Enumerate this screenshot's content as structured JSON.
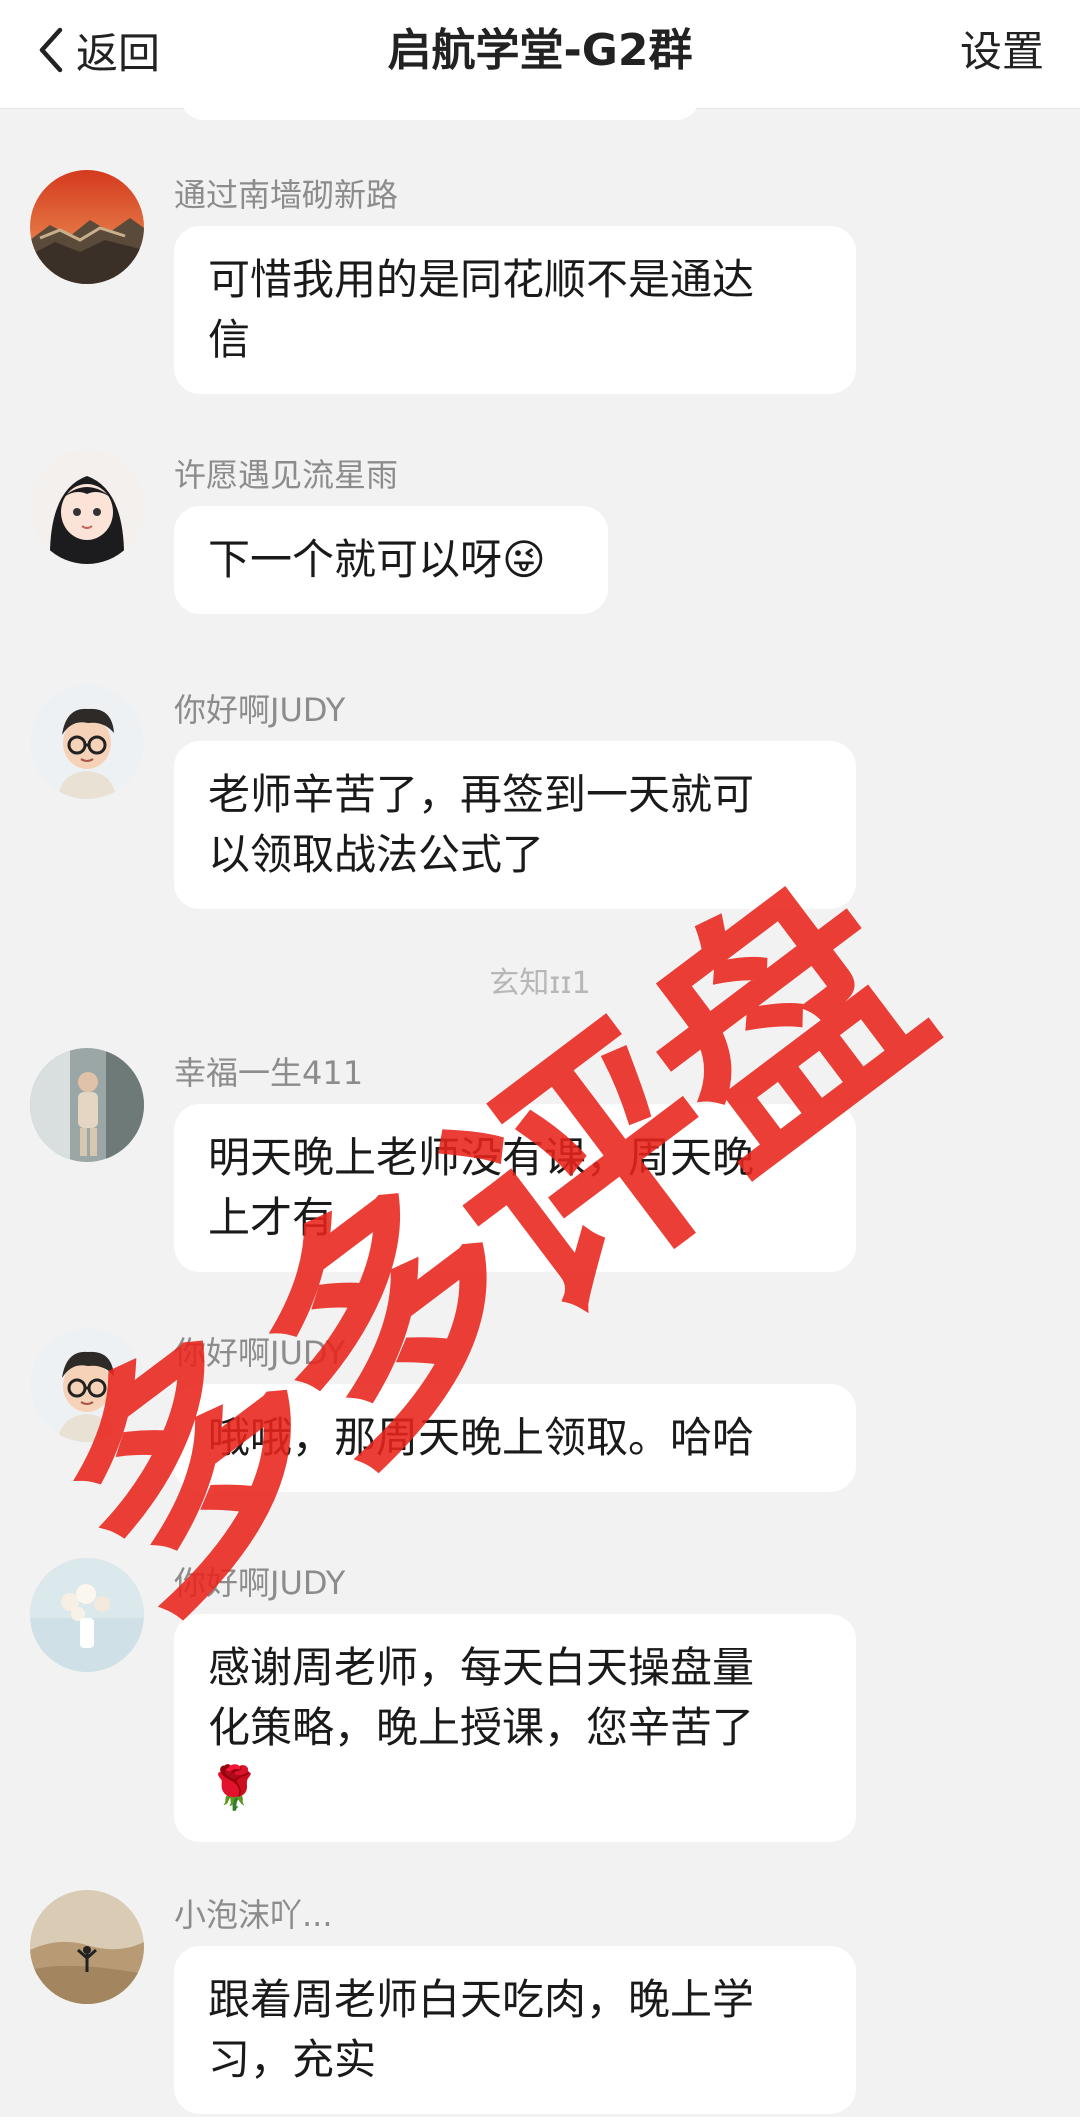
{
  "header": {
    "back_label": "返回",
    "title": "启航学堂-G2群",
    "settings_label": "设置"
  },
  "messages": [
    {
      "name": "通过南墙砌新路",
      "lines": [
        "可惜我用的是同花顺不是通达",
        "信"
      ],
      "avatar": "great-wall-sunset-avatar"
    },
    {
      "name": "许愿遇见流星雨",
      "lines": [
        "下一个就可以呀😜"
      ],
      "avatar": "anime-girl-avatar"
    },
    {
      "name": "你好啊JUDY",
      "lines": [
        "老师辛苦了，再签到一天就可",
        "以领取战法公式了"
      ],
      "avatar": "cartoon-boy-glasses-avatar"
    },
    {
      "name": "幸福一生411",
      "lines": [
        "明天晚上老师没有课，周天晚",
        "上才有"
      ],
      "avatar": "person-photo-avatar"
    },
    {
      "name": "你好啊JUDY",
      "lines": [
        "哦哦，那周天晚上领取。哈哈"
      ],
      "avatar": "cartoon-boy-glasses-avatar"
    },
    {
      "name": "你好啊JUDY",
      "lines": [
        "感谢周老师，每天白天操盘量",
        "化策略，晚上授课，您辛苦了",
        "🌹"
      ],
      "avatar": "flower-vase-avatar"
    },
    {
      "name": "小泡沫吖...",
      "lines": [
        "跟着周老师白天吃肉，晚上学",
        "习，充实"
      ],
      "avatar": "desert-silhouette-avatar"
    }
  ],
  "divider_text": "玄知ɪɪ1",
  "watermark_text": "多多评盘",
  "colors": {
    "watermark": "#e8231a",
    "background": "#f2f2f2",
    "bubble": "#ffffff",
    "name": "#8c8c8c"
  }
}
